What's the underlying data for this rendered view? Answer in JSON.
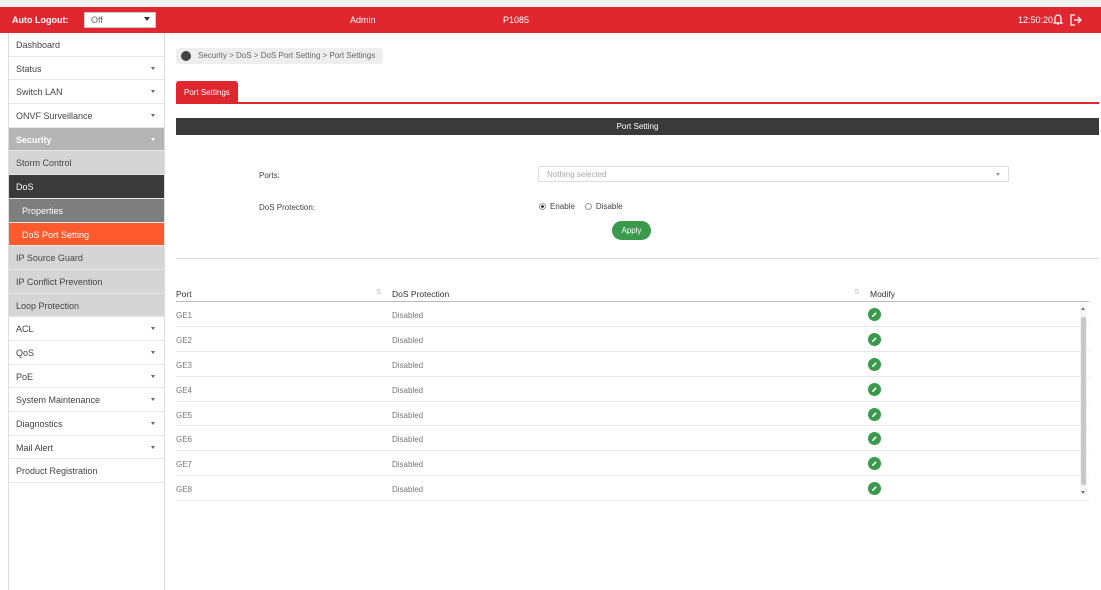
{
  "colors": {
    "brand": "#e0262f",
    "active": "#ff5a2d",
    "dark": "#3a3a3a",
    "success": "#3a9a4b"
  },
  "topbar": {
    "auto_logout_label": "Auto Logout:",
    "auto_logout_value": "Off",
    "user": "Admin",
    "model": "P1085",
    "clock": "12:50:20",
    "icons": [
      "bell-icon",
      "logout-icon"
    ]
  },
  "sidebar": {
    "items": [
      {
        "label": "Dashboard"
      },
      {
        "label": "Status"
      },
      {
        "label": "Switch LAN"
      },
      {
        "label": "ONVF Surveillance"
      },
      {
        "label": "Security"
      },
      {
        "label": "Storm Control"
      },
      {
        "label": "DoS"
      },
      {
        "label": "Properties"
      },
      {
        "label": "DoS Port Setting"
      },
      {
        "label": "IP Source Guard"
      },
      {
        "label": "IP Conflict Prevention"
      },
      {
        "label": "Loop Protection"
      },
      {
        "label": "ACL"
      },
      {
        "label": "QoS"
      },
      {
        "label": "PoE"
      },
      {
        "label": "System Maintenance"
      },
      {
        "label": "Diagnostics"
      },
      {
        "label": "Mail Alert"
      },
      {
        "label": "Product Registration"
      }
    ]
  },
  "breadcrumb": "Security > DoS > DoS Port Setting > Port Settings",
  "tab": "Port Settings",
  "section_title": "Port Setting",
  "form": {
    "ports_label": "Ports:",
    "ports_placeholder": "Nothing selected",
    "dos_label": "DoS Protection:",
    "enable_label": "Enable",
    "disable_label": "Disable",
    "selected": "Enable",
    "apply_label": "Apply"
  },
  "table": {
    "headers": {
      "port": "Port",
      "dos": "DoS Protection",
      "modify": "Modify"
    },
    "rows": [
      {
        "port": "GE1",
        "dos": "Disabled"
      },
      {
        "port": "GE2",
        "dos": "Disabled"
      },
      {
        "port": "GE3",
        "dos": "Disabled"
      },
      {
        "port": "GE4",
        "dos": "Disabled"
      },
      {
        "port": "GE5",
        "dos": "Disabled"
      },
      {
        "port": "GE6",
        "dos": "Disabled"
      },
      {
        "port": "GE7",
        "dos": "Disabled"
      },
      {
        "port": "GE8",
        "dos": "Disabled"
      }
    ]
  }
}
